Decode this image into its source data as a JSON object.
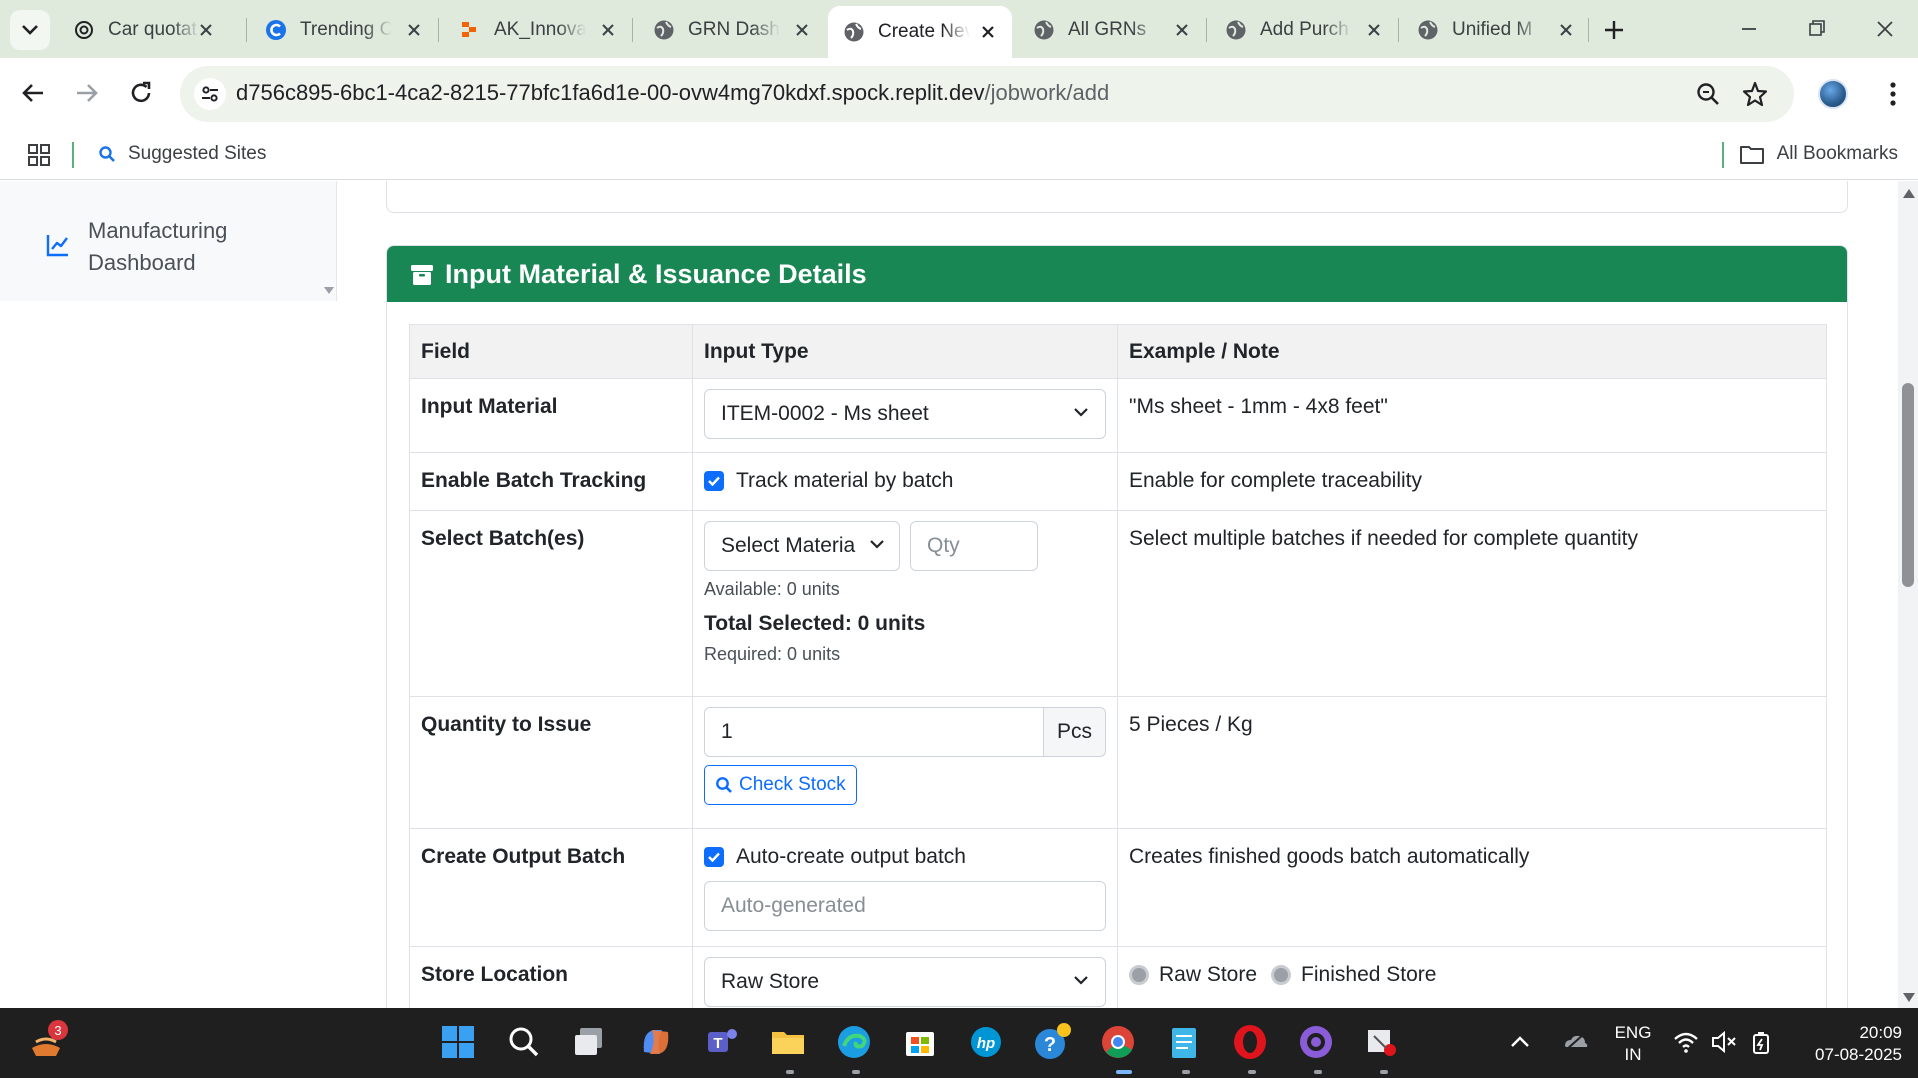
{
  "browser": {
    "tabs": [
      {
        "label": "Car quotat",
        "icon": "chatgpt-icon"
      },
      {
        "label": "Trending C",
        "icon": "c-logo-icon"
      },
      {
        "label": "AK_Innova",
        "icon": "replit-icon"
      },
      {
        "label": "GRN Dashb",
        "icon": "globe-icon"
      },
      {
        "label": "Create Nev",
        "icon": "globe-icon",
        "active": true
      },
      {
        "label": "All GRNs",
        "icon": "globe-icon"
      },
      {
        "label": "Add Purch",
        "icon": "globe-icon"
      },
      {
        "label": "Unified M",
        "icon": "globe-icon"
      }
    ],
    "url_host": "d756c895-6bc1-4ca2-8215-77bfc1fa6d1e-00-ovw4mg70kdxf.spock.replit.dev",
    "url_path": "/jobwork/add",
    "bookmarks": {
      "suggested": "Suggested Sites",
      "all": "All Bookmarks"
    }
  },
  "sidebar": {
    "item_label": "Manufacturing Dashboard"
  },
  "section": {
    "title": "Input Material & Issuance Details",
    "accent_color": "#198754"
  },
  "table": {
    "headers": [
      "Field",
      "Input Type",
      "Example / Note"
    ],
    "rows": {
      "input_material": {
        "field": "Input Material",
        "select_value": "ITEM-0002 - Ms sheet",
        "note": "\"Ms sheet - 1mm - 4x8 feet\""
      },
      "batch_tracking": {
        "field": "Enable Batch Tracking",
        "checkbox_label": "Track material by batch",
        "checked": true,
        "note": "Enable for complete traceability"
      },
      "select_batches": {
        "field": "Select Batch(es)",
        "batch_select": "Select Materia",
        "qty_placeholder": "Qty",
        "available": "Available: 0 units",
        "total_selected": "Total Selected: 0 units",
        "required": "Required: 0 units",
        "note": "Select multiple batches if needed for complete quantity"
      },
      "quantity_to_issue": {
        "field": "Quantity to Issue",
        "value": "1",
        "unit": "Pcs",
        "check_stock": "Check Stock",
        "note": "5 Pieces / Kg"
      },
      "output_batch": {
        "field": "Create Output Batch",
        "checkbox_label": "Auto-create output batch",
        "checked": true,
        "placeholder": "Auto-generated",
        "note": "Creates finished goods batch automatically"
      },
      "store_location": {
        "field": "Store Location",
        "select_value": "Raw Store",
        "radio_options": [
          "Raw Store",
          "Finished Store"
        ]
      }
    }
  },
  "taskbar": {
    "notification_count": "3",
    "language": "ENG",
    "region": "IN",
    "time": "20:09",
    "date": "07-08-2025"
  }
}
